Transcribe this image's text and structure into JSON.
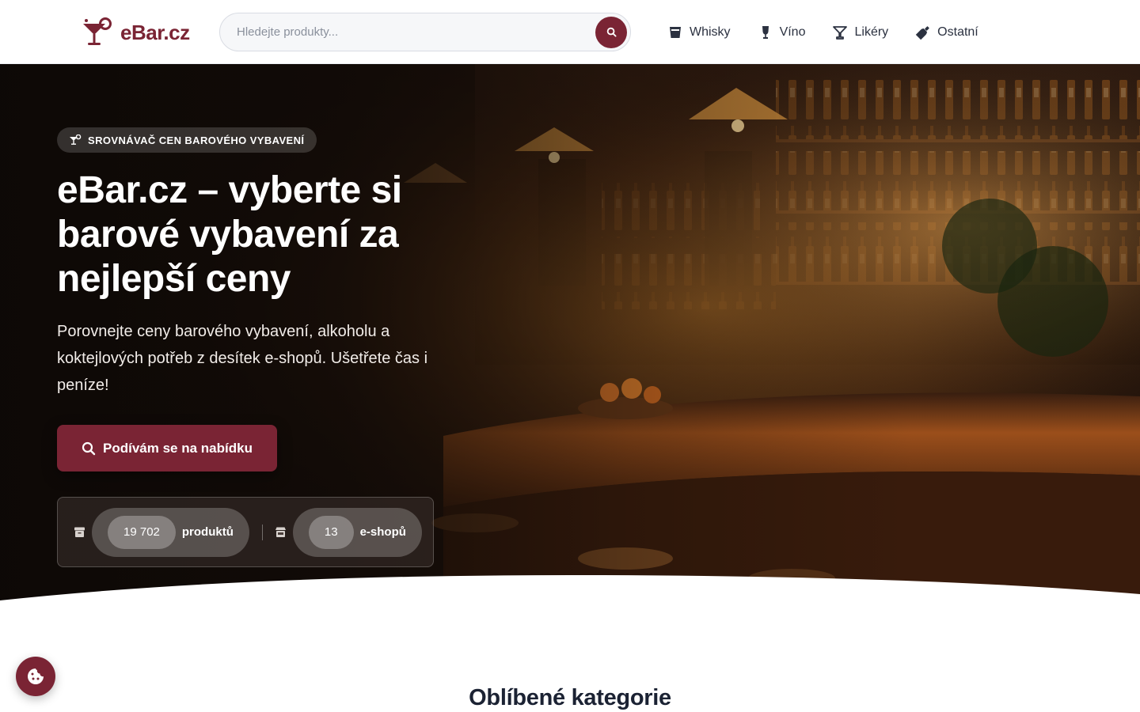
{
  "brand": {
    "name": "eBar.cz",
    "accent": "#7a2434"
  },
  "search": {
    "placeholder": "Hledejte produkty..."
  },
  "nav": [
    {
      "label": "Whisky",
      "icon": "whisky-glass-icon"
    },
    {
      "label": "Víno",
      "icon": "wine-bottle-icon"
    },
    {
      "label": "Likéry",
      "icon": "cocktail-glass-icon"
    },
    {
      "label": "Ostatní",
      "icon": "bottle-icon"
    }
  ],
  "hero": {
    "badge": "SROVNÁVAČ CEN BAROVÉHO VYBAVENÍ",
    "title": "eBar.cz – vyberte si barové vybavení za nejlepší ceny",
    "subtitle": "Porovnejte ceny barového vybavení, alkoholu a koktejlových potřeb z desítek e-shopů. Ušetřete čas i peníze!",
    "cta": "Podívám se na nabídku",
    "stats": [
      {
        "value": "19 702",
        "label": "produktů",
        "icon": "box-icon"
      },
      {
        "value": "13",
        "label": "e-shopů",
        "icon": "store-icon"
      }
    ]
  },
  "sections": {
    "popular_title": "Oblíbené kategorie"
  },
  "cookie": {
    "icon": "cookie-icon"
  }
}
